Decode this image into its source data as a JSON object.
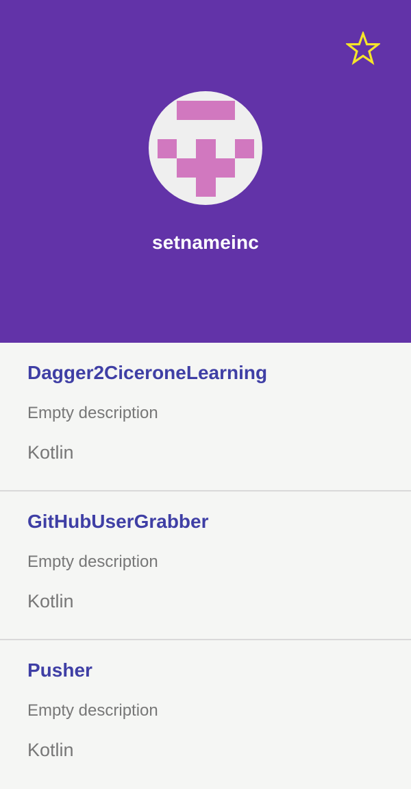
{
  "profile": {
    "username": "setnameinc",
    "favorite_icon": "star-outline-icon",
    "avatar_icon": "identicon",
    "colors": {
      "header_bg": "#6233a8",
      "star": "#f5e52a",
      "avatar_bg": "#efefef",
      "avatar_fg": "#d178bf",
      "repo_name": "#3f3fa5",
      "repo_text": "#777777",
      "list_bg": "#f5f6f4"
    }
  },
  "repos": [
    {
      "name": "Dagger2CiceroneLearning",
      "description": "Empty description",
      "language": "Kotlin"
    },
    {
      "name": "GitHubUserGrabber",
      "description": "Empty description",
      "language": "Kotlin"
    },
    {
      "name": "Pusher",
      "description": "Empty description",
      "language": "Kotlin"
    }
  ]
}
